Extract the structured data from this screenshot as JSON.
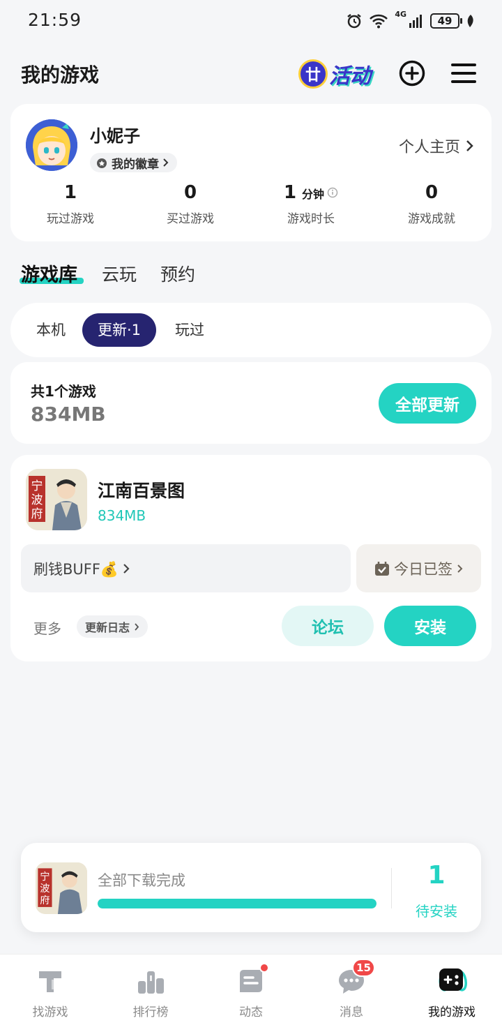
{
  "status_bar": {
    "time": "21:59",
    "network": "4G",
    "battery": "49"
  },
  "header": {
    "title": "我的游戏",
    "activity_badge": "廿",
    "activity_label": "活动"
  },
  "profile": {
    "username": "小妮子",
    "badge_label": "我的徽章",
    "homepage_label": "个人主页",
    "stats": [
      {
        "value": "1",
        "unit": "",
        "label": "玩过游戏"
      },
      {
        "value": "0",
        "unit": "",
        "label": "买过游戏"
      },
      {
        "value": "1",
        "unit": "分钟",
        "label": "游戏时长"
      },
      {
        "value": "0",
        "unit": "",
        "label": "游戏成就"
      }
    ]
  },
  "main_tabs": [
    {
      "label": "游戏库",
      "active": true
    },
    {
      "label": "云玩",
      "active": false
    },
    {
      "label": "预约",
      "active": false
    }
  ],
  "filters": [
    {
      "label": "本机",
      "active": false
    },
    {
      "label": "更新·1",
      "active": true
    },
    {
      "label": "玩过",
      "active": false
    }
  ],
  "summary": {
    "title": "共1个游戏",
    "size": "834MB",
    "update_all_label": "全部更新"
  },
  "game": {
    "name": "江南百景图",
    "size": "834MB",
    "icon_text": [
      "宁",
      "波",
      "府"
    ],
    "buff_label": "刷钱BUFF💰",
    "signed_label": "今日已签",
    "more_label": "更多",
    "changelog_label": "更新日志",
    "forum_label": "论坛",
    "install_label": "安装"
  },
  "download_panel": {
    "status": "全部下载完成",
    "progress": 1.0,
    "pending_count": "1",
    "pending_label": "待安装"
  },
  "bottom_nav": [
    {
      "label": "找游戏",
      "icon": "find-game-icon",
      "active": false
    },
    {
      "label": "排行榜",
      "icon": "ranking-icon",
      "active": false
    },
    {
      "label": "动态",
      "icon": "feed-icon",
      "active": false,
      "dot": true
    },
    {
      "label": "消息",
      "icon": "message-icon",
      "active": false,
      "badge": "15"
    },
    {
      "label": "我的游戏",
      "icon": "my-games-icon",
      "active": true
    }
  ],
  "colors": {
    "accent": "#24d3c3",
    "active_filter": "#262470",
    "badge_red": "#f04848"
  }
}
